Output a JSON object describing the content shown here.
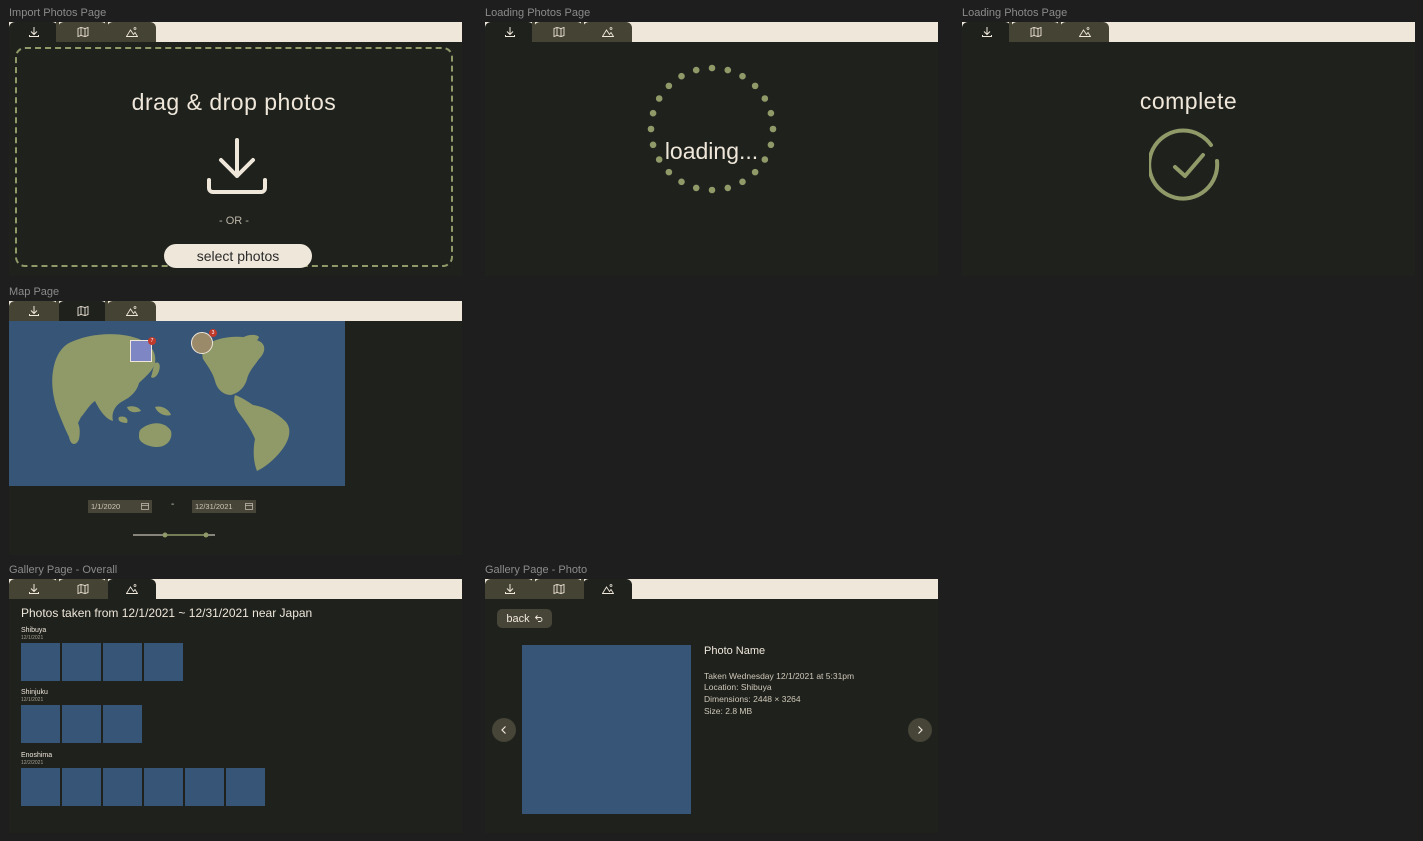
{
  "frames": {
    "import": {
      "label": "Import Photos Page"
    },
    "loading": {
      "label": "Loading Photos Page"
    },
    "complete": {
      "label": "Loading Photos Page"
    },
    "map": {
      "label": "Map Page"
    },
    "gallery_overall": {
      "label": "Gallery Page - Overall"
    },
    "gallery_photo": {
      "label": "Gallery Page - Photo"
    }
  },
  "tabs": [
    "import-icon",
    "map-icon",
    "gallery-icon"
  ],
  "import_page": {
    "title": "drag & drop photos",
    "or_text": "- OR -",
    "select_button": "select photos"
  },
  "loading_page": {
    "text": "loading..."
  },
  "complete_page": {
    "text": "complete"
  },
  "map_page": {
    "start_date": "1/1/2020",
    "end_date": "12/31/2021",
    "separator": "-",
    "markers": [
      {
        "name": "japan-photo-marker",
        "badge": "7"
      },
      {
        "name": "america-photo-marker",
        "badge": "3"
      }
    ]
  },
  "gallery_overall": {
    "title": "Photos taken from 12/1/2021 ~ 12/31/2021 near Japan",
    "groups": [
      {
        "location": "Shibuya",
        "date": "12/1/2021",
        "count": 4
      },
      {
        "location": "Shinjuku",
        "date": "12/1/2021",
        "count": 3
      },
      {
        "location": "Enoshima",
        "date": "12/2/2021",
        "count": 6
      }
    ]
  },
  "gallery_photo": {
    "back_label": "back",
    "photo_name": "Photo Name",
    "taken": "Taken Wednesday 12/1/2021 at 5:31pm",
    "location": "Location: Shibuya",
    "dimensions": "Dimensions: 2448 × 3264",
    "size": "Size: 2.8 MB"
  },
  "colors": {
    "background": "#1e1e1e",
    "frame_bg": "#1f211d",
    "tab_bar": "#efe7da",
    "tab": "#454334",
    "accent_green": "#8f9a68",
    "map_water": "#375577",
    "land": "#8f9a68"
  }
}
